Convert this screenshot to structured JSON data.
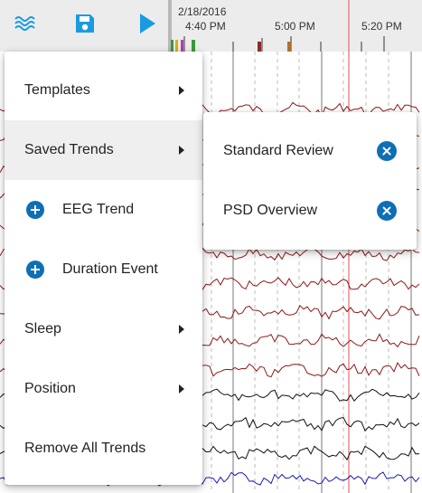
{
  "toolbar": {
    "icons": [
      "waves-icon",
      "save-icon",
      "play-icon"
    ],
    "date": "2/18/2016",
    "time_labels": [
      "4:40 PM",
      "5:00 PM",
      "5:20 PM"
    ]
  },
  "menu": {
    "items": [
      {
        "label": "Templates",
        "has_submenu": true
      },
      {
        "label": "Saved Trends",
        "has_submenu": true,
        "active": true
      },
      {
        "label": "EEG Trend",
        "icon": "plus-circle-icon"
      },
      {
        "label": "Duration Event",
        "icon": "plus-circle-icon"
      },
      {
        "label": "Sleep",
        "has_submenu": true
      },
      {
        "label": "Position",
        "has_submenu": true
      },
      {
        "label": "Remove All Trends"
      }
    ]
  },
  "submenu": {
    "items": [
      {
        "label": "Standard Review",
        "icon": "close-circle-icon"
      },
      {
        "label": "PSD Overview",
        "icon": "close-circle-icon"
      }
    ]
  },
  "colors": {
    "accent": "#1a9be0",
    "icon_blue": "#0e6fb4",
    "trace_red": "#8b1a1a",
    "trace_black": "#111111",
    "trace_blue": "#1a1ab4",
    "marker_red": "#e05050"
  }
}
